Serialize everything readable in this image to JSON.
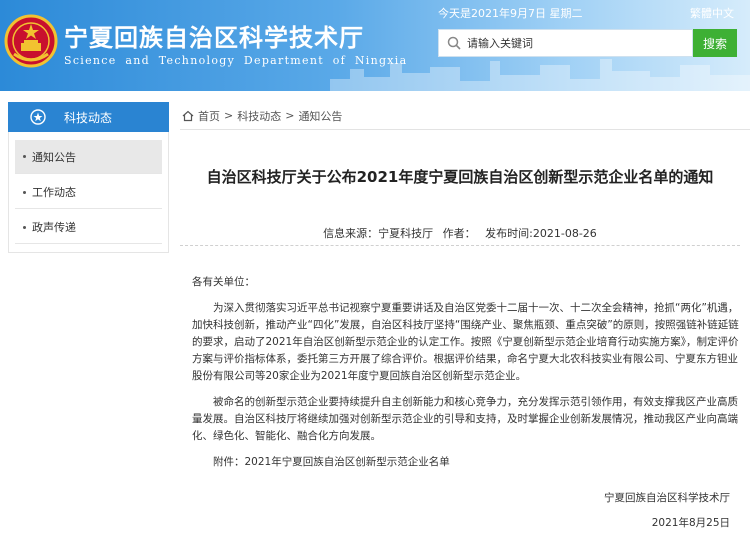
{
  "header": {
    "title": "宁夏回族自治区科学技术厅",
    "subtitle": "Science and Technology Department of Ningxia",
    "date_line": "今天是2021年9月7日 星期二",
    "lang_switch": "繁體中文",
    "search_placeholder": "请输入关键词",
    "search_button": "搜索"
  },
  "sidebar": {
    "heading": "科技动态",
    "items": [
      {
        "label": "通知公告"
      },
      {
        "label": "工作动态"
      },
      {
        "label": "政声传递"
      }
    ]
  },
  "breadcrumb": {
    "home": "首页",
    "level1": "科技动态",
    "level2": "通知公告",
    "sep": ">"
  },
  "article": {
    "title": "自治区科技厅关于公布2021年度宁夏回族自治区创新型示范企业名单的通知",
    "source": "信息来源：宁夏科技厅",
    "author": "作者：",
    "publish_time": "发布时间:2021-08-26",
    "salutation": "各有关单位：",
    "paragraph1": "为深入贯彻落实习近平总书记视察宁夏重要讲话及自治区党委十二届十一次、十二次全会精神，抢抓“两化”机遇，加快科技创新，推动产业“四化”发展，自治区科技厅坚持“围绕产业、聚焦瓶颈、重点突破”的原则，按照强链补链延链的要求，启动了2021年自治区创新型示范企业的认定工作。按照《宁夏创新型示范企业培育行动实施方案》，制定评价方案与评价指标体系，委托第三方开展了综合评价。根据评价结果，命名宁夏大北农科技实业有限公司、宁夏东方钽业股份有限公司等20家企业为2021年度宁夏回族自治区创新型示范企业。",
    "paragraph2": "被命名的创新型示范企业要持续提升自主创新能力和核心竞争力，充分发挥示范引领作用，有效支撑我区产业高质量发展。自治区科技厅将继续加强对创新型示范企业的引导和支持，及时掌握企业创新发展情况，推动我区产业向高端化、绿色化、智能化、融合化方向发展。",
    "attachment": "附件：2021年宁夏回族自治区创新型示范企业名单",
    "signature": "宁夏回族自治区科学技术厅",
    "sign_date": "2021年8月25日"
  },
  "colors": {
    "header_blue": "#2c8ad8",
    "sidebar_blue": "#2a84d2",
    "search_green": "#3eb034"
  },
  "icons": [
    "national-emblem-icon",
    "search-icon",
    "news-icon",
    "home-icon"
  ]
}
